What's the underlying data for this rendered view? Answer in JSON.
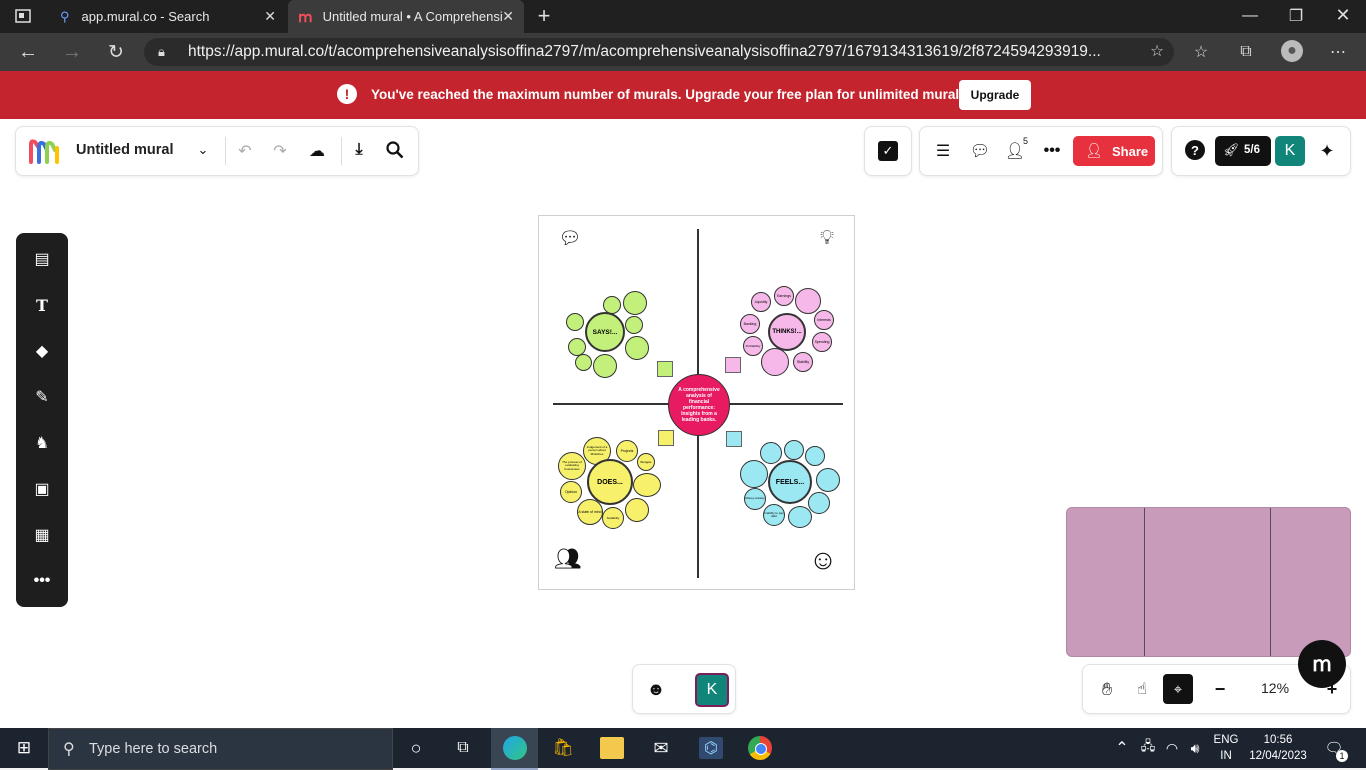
{
  "browser": {
    "tabs": [
      {
        "title": "app.mural.co - Search",
        "active": false
      },
      {
        "title": "Untitled mural • A Comprehensiv",
        "active": true
      }
    ],
    "url": "https://app.mural.co/t/acomprehensiveanalysisoffina2797/m/acomprehensiveanalysisoffina2797/1679134313619/2f8724594293919..."
  },
  "banner": {
    "message": "You've reached the maximum number of murals. Upgrade your free plan for unlimited murals.",
    "upgrade_label": "Upgrade"
  },
  "toolbar": {
    "mural_title": "Untitled mural",
    "collaborator_count": "5",
    "share_label": "Share",
    "onboarding_progress": "5/6",
    "avatar_initial": "K"
  },
  "board": {
    "center_title": "A comprehensive analysis of financial performance: Insights from a leading banks.",
    "says": {
      "label": "SAYS!..."
    },
    "thinks": {
      "label": "THINKS!..."
    },
    "does": {
      "label": "DOES..."
    },
    "feels": {
      "label": "FEELS..."
    },
    "does_items": [
      "Judgement of a person about Ministries",
      "Projects",
      "Budgets",
      "The process of evaluating businesses",
      "Opinion",
      "A state of mind",
      "Suitability"
    ],
    "thinks_items": [
      "Liquidity",
      "Earnings",
      "Banking",
      "Interests",
      "Profitability",
      "Spending",
      "Stability"
    ],
    "feels_items": [
      "Inability to pay debt",
      "Money anxiety"
    ]
  },
  "zoom": {
    "level": "12%"
  },
  "reactions": {
    "avatar_initial": "K"
  },
  "taskbar": {
    "search_placeholder": "Type here to search",
    "language": "ENG",
    "region": "IN",
    "time": "10:56",
    "date": "12/04/2023",
    "notification_count": "1"
  },
  "colors": {
    "banner_red": "#c4242d",
    "share_red": "#e8313f",
    "avatar_teal": "#12857a",
    "says_green": "#c2f07a",
    "thinks_pink": "#f6b8e8",
    "does_yellow": "#f6f06a",
    "feels_cyan": "#9be7f2",
    "center_magenta": "#e81a62",
    "minimap_mauve": "#c99bbb"
  }
}
